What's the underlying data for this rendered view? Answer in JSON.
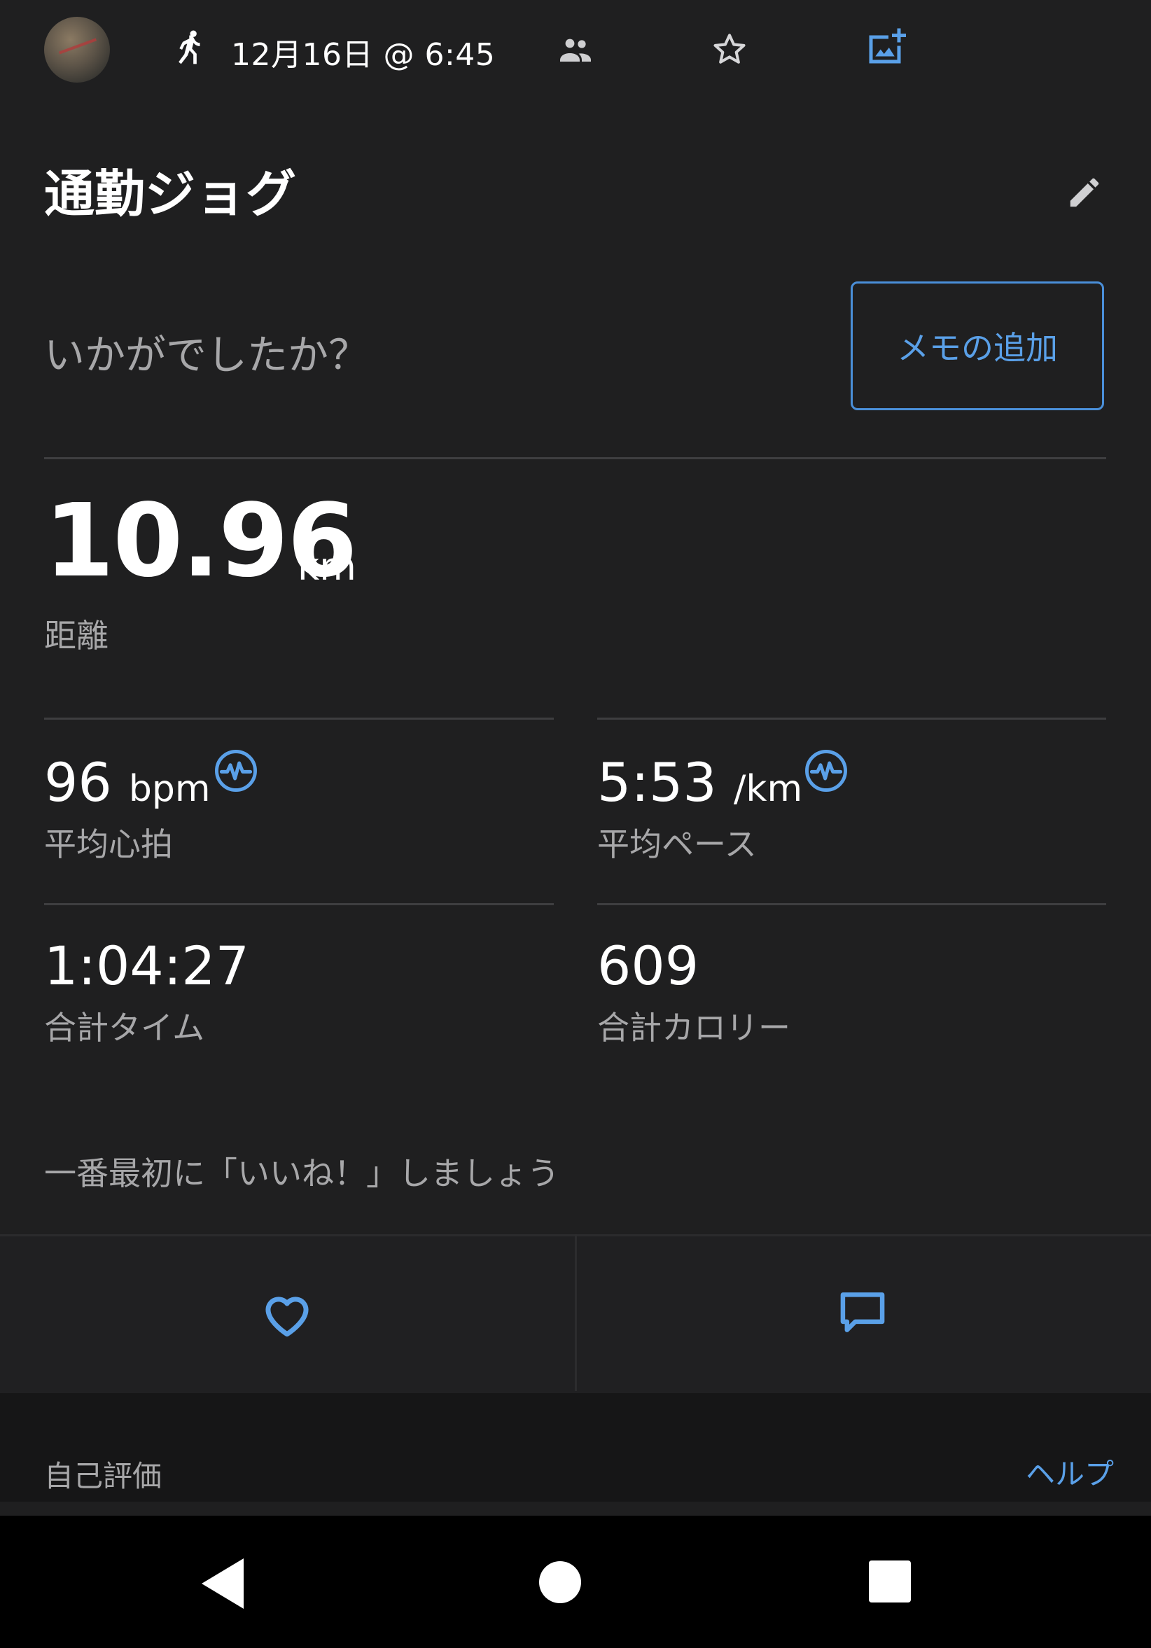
{
  "header": {
    "date_time": "12月16日 @ 6:45",
    "icons": {
      "activity": "running-icon",
      "privacy": "people-icon",
      "favorite": "star-icon",
      "add_photo": "add-photo-icon"
    }
  },
  "activity": {
    "title": "通勤ジョグ",
    "prompt": "いかがでしたか？",
    "memo_button": "メモの追加"
  },
  "stats": {
    "distance": {
      "value": "10.96",
      "unit": "km",
      "label": "距離"
    },
    "avg_hr": {
      "value": "96",
      "unit": "bpm",
      "label": "平均心拍"
    },
    "avg_pace": {
      "value": "5:53",
      "unit": "/km",
      "label": "平均ペース"
    },
    "total_time": {
      "value": "1:04:27",
      "label": "合計タイム"
    },
    "calories": {
      "value": "609",
      "label": "合計カロリー"
    }
  },
  "social": {
    "like_prompt": "一番最初に「いいね！」しましょう"
  },
  "self_evaluation": {
    "label": "自己評価",
    "help": "ヘルプ"
  },
  "colors": {
    "accent": "#5aa0e8",
    "background": "#1f1f20"
  }
}
